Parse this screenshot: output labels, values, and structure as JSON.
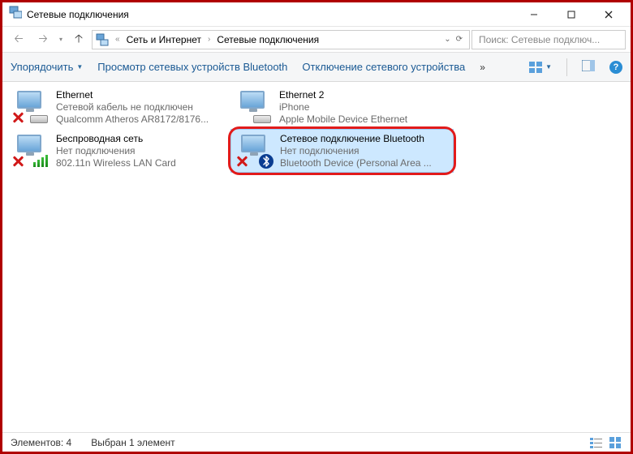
{
  "window": {
    "title": "Сетевые подключения"
  },
  "breadcrumb": {
    "seg1": "Сеть и Интернет",
    "seg2": "Сетевые подключения"
  },
  "search": {
    "placeholder": "Поиск: Сетевые подключ..."
  },
  "toolbar": {
    "organize": "Упорядочить",
    "view_bt": "Просмотр сетевых устройств Bluetooth",
    "disable": "Отключение сетевого устройства"
  },
  "items": [
    {
      "name": "Ethernet",
      "status": "Сетевой кабель не подключен",
      "device": "Qualcomm Atheros AR8172/8176...",
      "kind": "ethernet",
      "disabled": true
    },
    {
      "name": "Ethernet 2",
      "status": "iPhone",
      "device": "Apple Mobile Device Ethernet",
      "kind": "ethernet",
      "disabled": false
    },
    {
      "name": "Беспроводная сеть",
      "status": "Нет подключения",
      "device": "802.11n Wireless LAN Card",
      "kind": "wifi",
      "disabled": true
    },
    {
      "name": "Сетевое подключение Bluetooth",
      "status": "Нет подключения",
      "device": "Bluetooth Device (Personal Area ...",
      "kind": "bt",
      "disabled": true,
      "selected": true,
      "highlighted": true
    }
  ],
  "status": {
    "count_label": "Элементов: 4",
    "selection_label": "Выбран 1 элемент"
  }
}
